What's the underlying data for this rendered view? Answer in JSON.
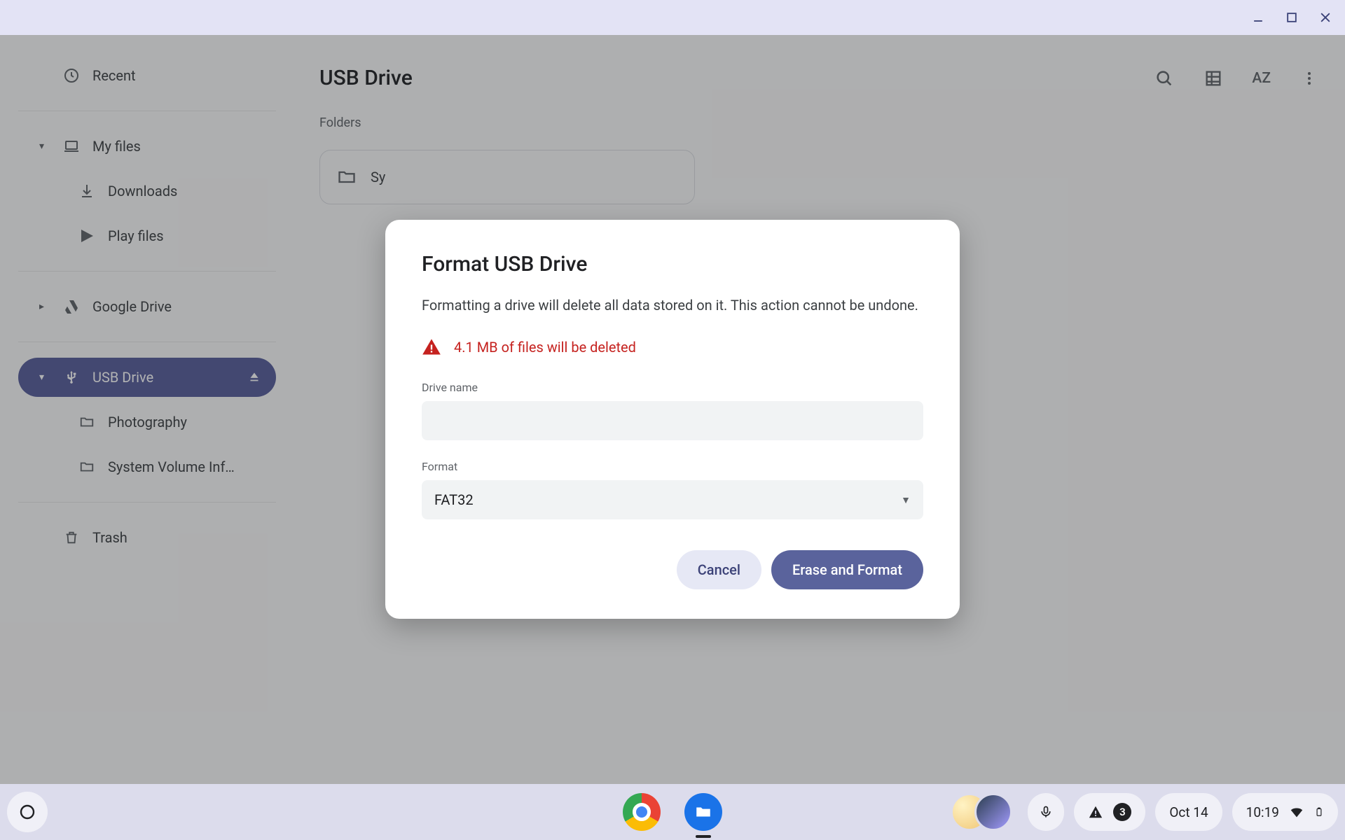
{
  "sidebar": {
    "recent": "Recent",
    "my_files": "My files",
    "downloads": "Downloads",
    "play_files": "Play files",
    "google_drive": "Google Drive",
    "usb_drive": "USB Drive",
    "usb_children": {
      "photography": "Photography",
      "svi": "System Volume Inf…"
    },
    "trash": "Trash"
  },
  "header": {
    "title": "USB Drive"
  },
  "content": {
    "folders_label": "Folders",
    "folder_tile_name": "Sy"
  },
  "dialog": {
    "title": "Format USB Drive",
    "description": "Formatting a drive will delete all data stored on it. This action cannot be undone.",
    "warning": "4.1 MB of files will be deleted",
    "drive_name_label": "Drive name",
    "drive_name_value": "",
    "format_label": "Format",
    "format_selected": "FAT32",
    "cancel": "Cancel",
    "confirm": "Erase and Format"
  },
  "shelf": {
    "date": "Oct 14",
    "time": "10:19",
    "notif_count": "3"
  }
}
